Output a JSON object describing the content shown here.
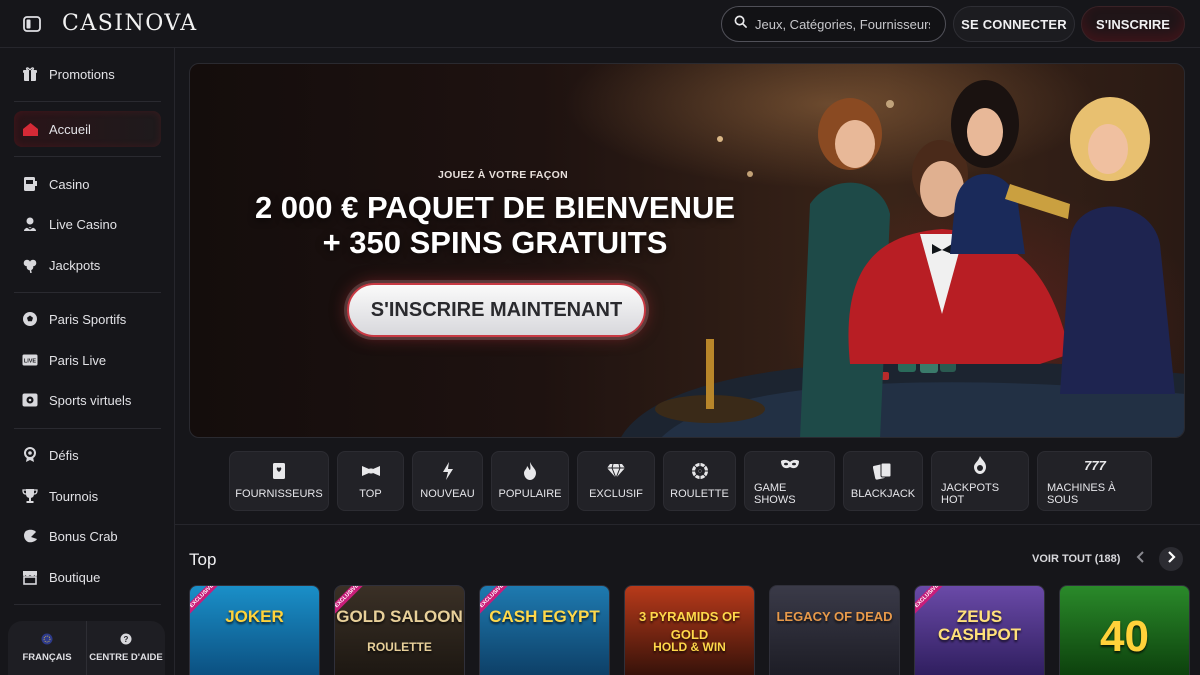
{
  "brand": {
    "logo_text": "CASINOVA"
  },
  "header": {
    "search_placeholder": "Jeux, Catégories, Fournisseurs",
    "login_label": "SE CONNECTER",
    "signup_label": "S'INSCRIRE"
  },
  "sidebar": {
    "items": [
      {
        "label": "Promotions",
        "icon": "gift-icon"
      },
      {
        "label": "Accueil",
        "icon": "home-icon",
        "active": true
      },
      {
        "label": "Casino",
        "icon": "slot-machine-icon"
      },
      {
        "label": "Live Casino",
        "icon": "dealer-icon"
      },
      {
        "label": "Jackpots",
        "icon": "clover-icon"
      },
      {
        "label": "Paris Sportifs",
        "icon": "soccer-ball-icon"
      },
      {
        "label": "Paris Live",
        "icon": "live-icon"
      },
      {
        "label": "Sports virtuels",
        "icon": "virtual-sports-icon"
      },
      {
        "label": "Défis",
        "icon": "challenge-icon"
      },
      {
        "label": "Tournois",
        "icon": "trophy-icon"
      },
      {
        "label": "Bonus Crab",
        "icon": "crab-icon"
      },
      {
        "label": "Boutique",
        "icon": "shop-icon"
      }
    ],
    "bottom": {
      "language_label": "FRANÇAIS",
      "help_label": "CENTRE D'AIDE"
    }
  },
  "hero": {
    "eyebrow": "JOUEZ À VOTRE FAÇON",
    "title_line1": "2 000 € PAQUET DE BIENVENUE",
    "title_line2": "+ 350 SPINS GRATUITS",
    "cta_label": "S'INSCRIRE MAINTENANT"
  },
  "categories": [
    {
      "label": "FOURNISSEURS",
      "icon": "providers-icon"
    },
    {
      "label": "TOP",
      "icon": "bow-tie-icon"
    },
    {
      "label": "NOUVEAU",
      "icon": "lightning-icon"
    },
    {
      "label": "POPULAIRE",
      "icon": "flame-icon"
    },
    {
      "label": "EXCLUSIF",
      "icon": "diamond-icon"
    },
    {
      "label": "ROULETTE",
      "icon": "roulette-icon"
    },
    {
      "label": "GAME SHOWS",
      "icon": "mask-icon"
    },
    {
      "label": "BLACKJACK",
      "icon": "cards-icon"
    },
    {
      "label": "JACKPOTS HOT",
      "icon": "hot-jackpot-icon"
    },
    {
      "label": "MACHINES À SOUS",
      "icon": "777-icon"
    }
  ],
  "top_section": {
    "title": "Top",
    "view_all_label": "VOIR TOUT (188)",
    "games": [
      {
        "title": "JOKER",
        "badge": "EXCLUSIVE",
        "colors": [
          "#1a8fc8",
          "#0a4a7a"
        ],
        "text_color": "#ffd23a"
      },
      {
        "title": "GOLD SALOON",
        "subtitle": "ROULETTE",
        "badge": "EXCLUSIVE",
        "colors": [
          "#3a3026",
          "#1a1510"
        ],
        "text_color": "#e8d09a"
      },
      {
        "title": "CASH EGYPT",
        "badge": "EXCLUSIVE",
        "colors": [
          "#1e7ab0",
          "#0c3a60"
        ],
        "text_color": "#ffd84a"
      },
      {
        "title": "3 PYRAMIDS OF GOLD",
        "subtitle": "HOLD & WIN",
        "colors": [
          "#b83a1a",
          "#2a0e08"
        ],
        "text_color": "#ffd84a"
      },
      {
        "title": "LEGACY OF DEAD",
        "colors": [
          "#3a3a48",
          "#1a1a22"
        ],
        "text_color": "#e89a4a"
      },
      {
        "title": "ZEUS CASHPOT",
        "badge": "EXCLUSIVE",
        "colors": [
          "#6a4aa8",
          "#2a1a58"
        ],
        "text_color": "#ffe07a"
      },
      {
        "title": "40",
        "colors": [
          "#2a8a2a",
          "#0a3a0a"
        ],
        "text_color": "#ffd23a"
      }
    ]
  },
  "colors": {
    "background": "#16161a",
    "accent_red": "#c83a44",
    "badge_pink": "#c81e7a"
  }
}
